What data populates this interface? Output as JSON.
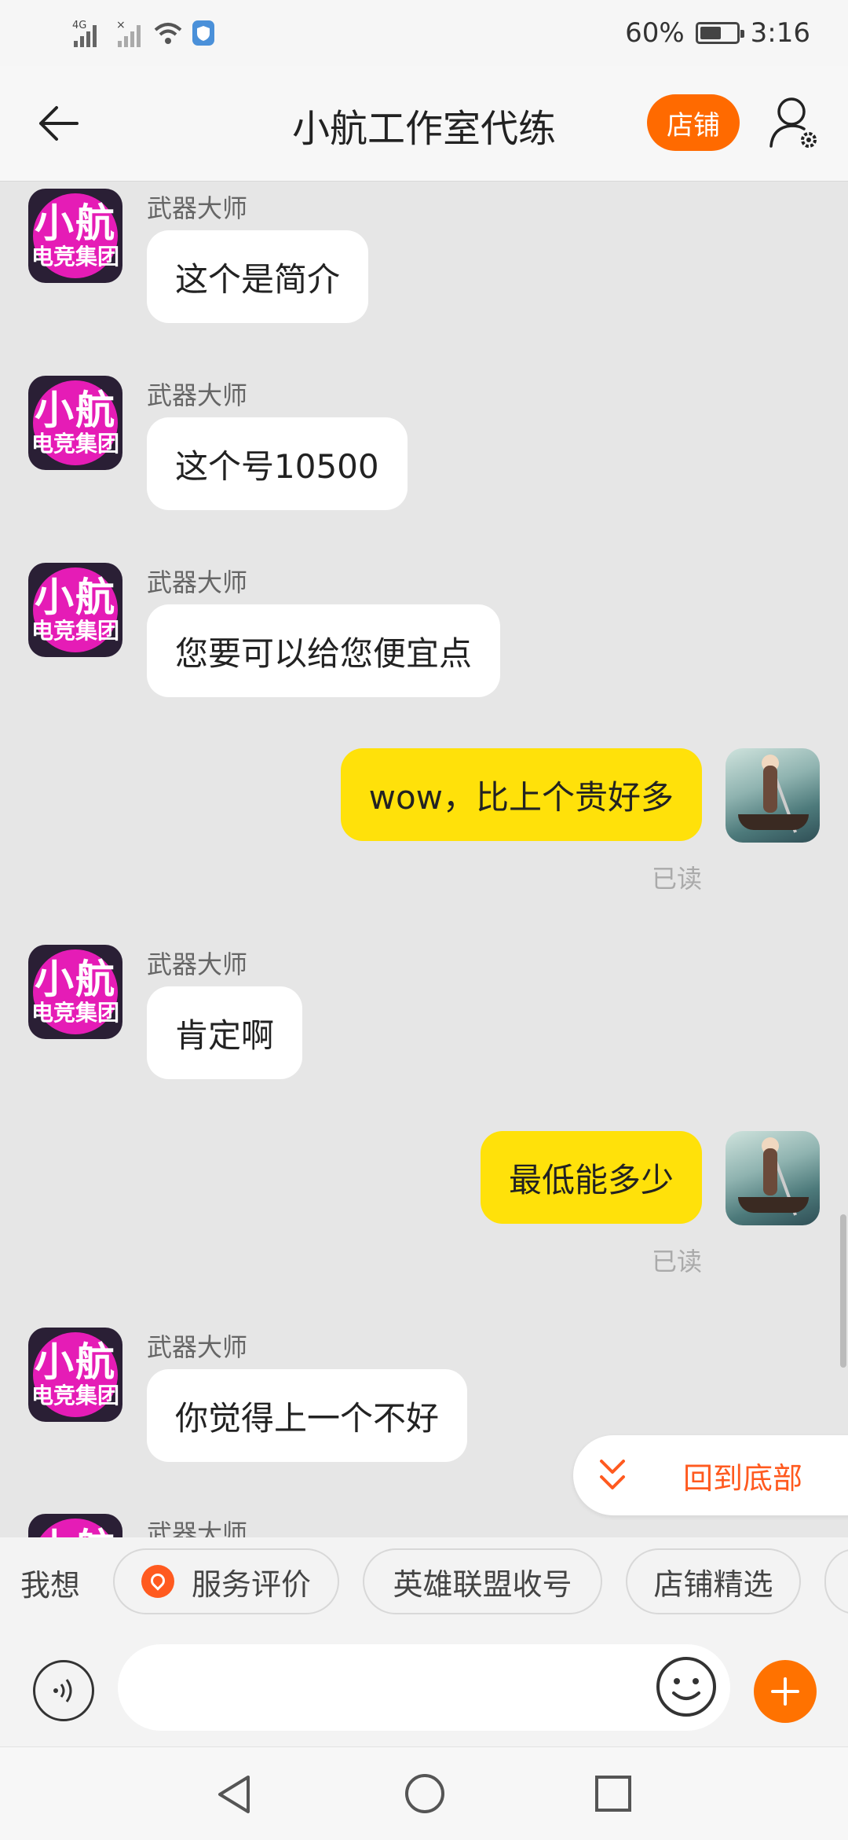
{
  "status_bar": {
    "network": "4G",
    "battery": "60%",
    "battery_level": 0.6,
    "time": "3:16"
  },
  "header": {
    "title": "小航工作室代练",
    "shop_button": "店铺"
  },
  "avatar_text": {
    "line1": "小航",
    "line2": "电竞集团"
  },
  "messages": [
    {
      "side": "in",
      "sender": "武器大师",
      "text": "这个是简介"
    },
    {
      "side": "in",
      "sender": "武器大师",
      "text": "这个号10500"
    },
    {
      "side": "in",
      "sender": "武器大师",
      "text": "您要可以给您便宜点"
    },
    {
      "side": "out",
      "text": "wow，比上个贵好多",
      "status": "已读"
    },
    {
      "side": "in",
      "sender": "武器大师",
      "text": "肯定啊"
    },
    {
      "side": "out",
      "text": "最低能多少",
      "status": "已读"
    },
    {
      "side": "in",
      "sender": "武器大师",
      "text": "你觉得上一个不好"
    },
    {
      "side": "in",
      "sender": "武器大师",
      "text": ""
    }
  ],
  "back_to_bottom": "回到底部",
  "quick_bar": {
    "prefix": "我想",
    "chips": [
      "服务评价",
      "英雄联盟收号",
      "店铺精选"
    ]
  },
  "colors": {
    "accent": "#ff6a00",
    "bubble_out": "#ffe10a",
    "avatar_pink": "#e51cb6"
  }
}
